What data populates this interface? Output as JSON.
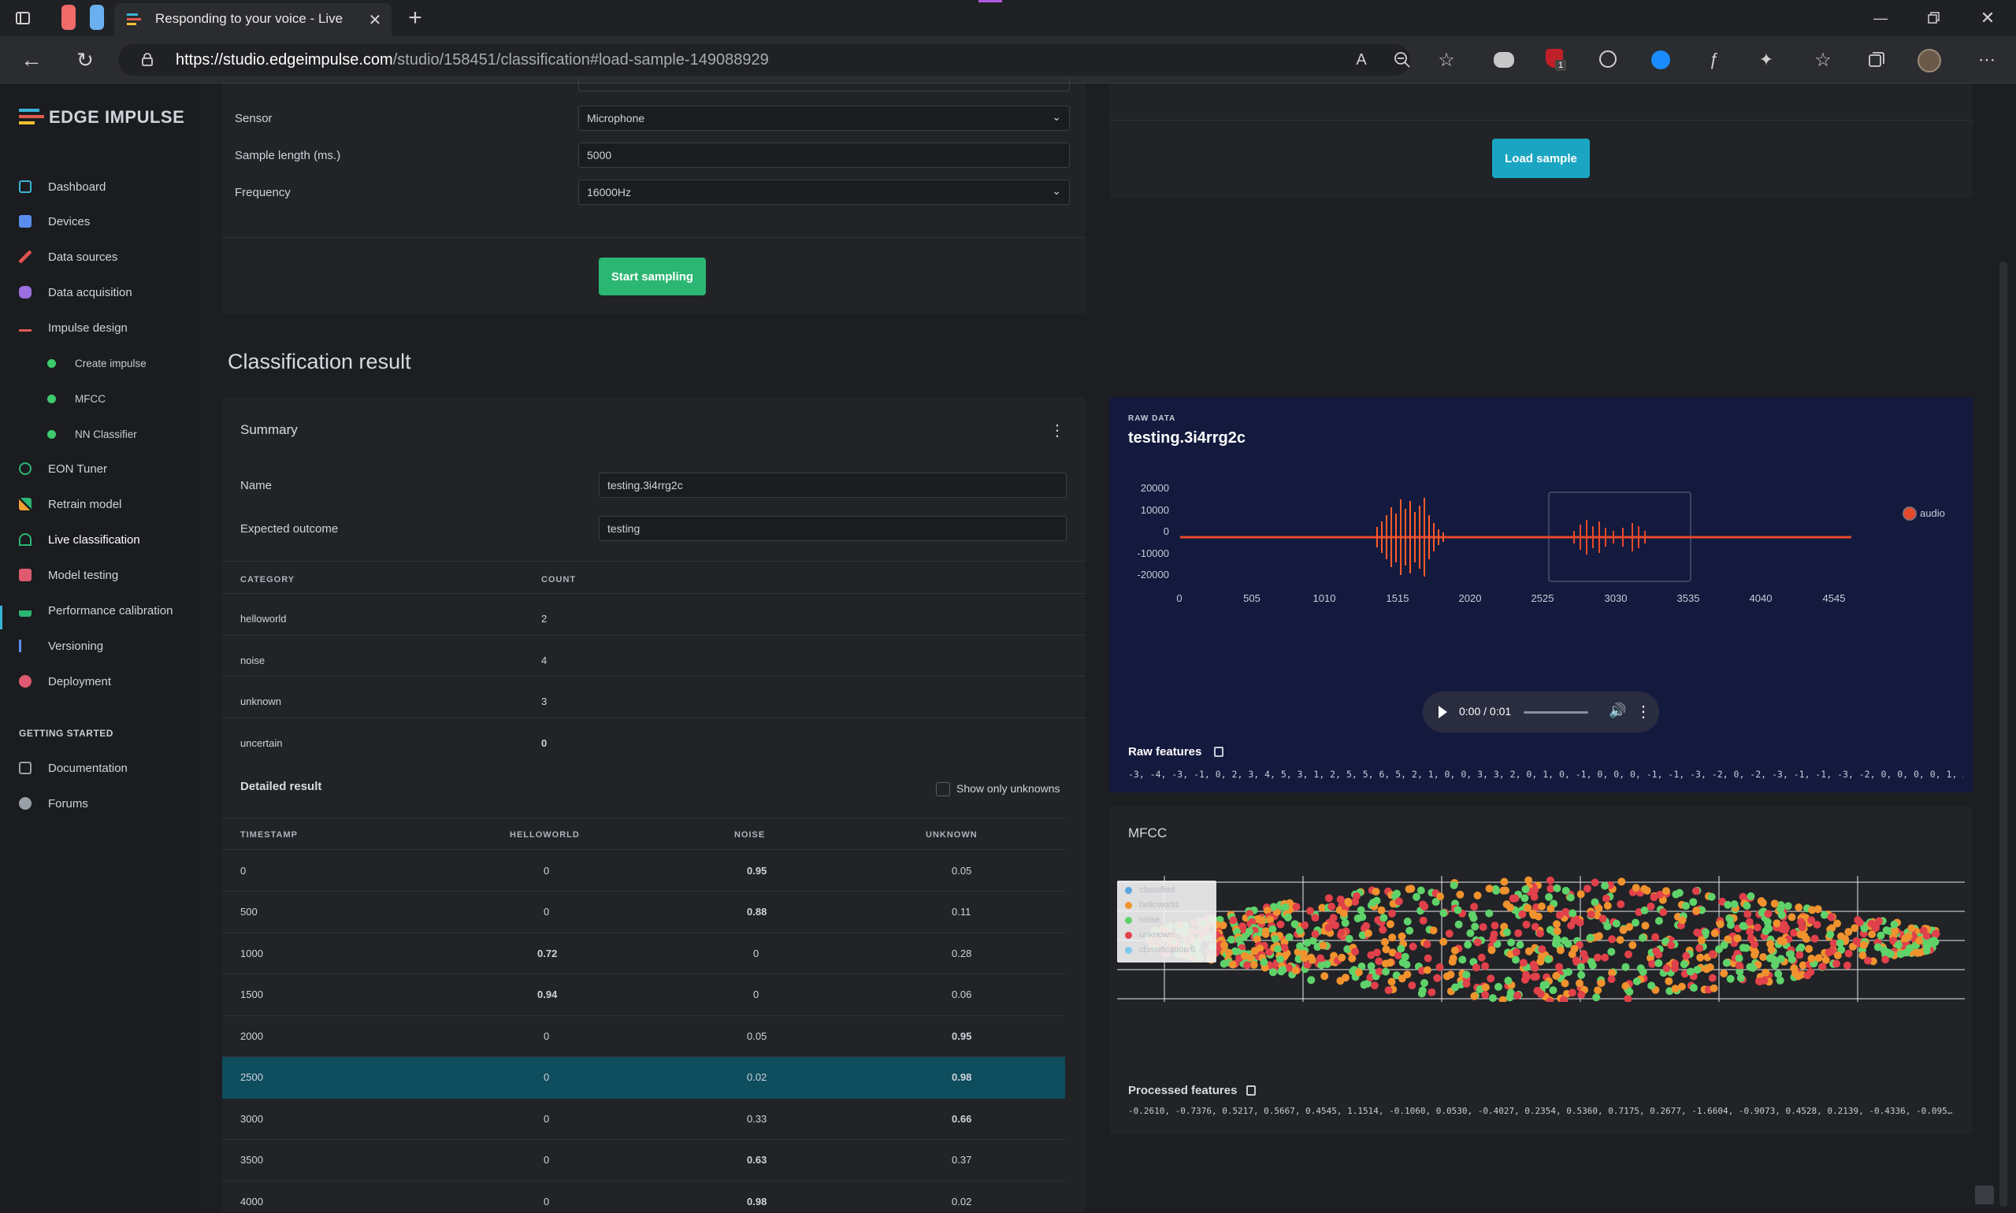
{
  "browser": {
    "tab_title": "Responding to your voice - Live",
    "url_host": "https://studio.edgeimpulse.com",
    "url_path": "/studio/158451/classification#load-sample-149088929",
    "new_tab": "+",
    "ext_badge": "1"
  },
  "sidebar": {
    "logo": "EDGE IMPULSE",
    "items": [
      {
        "label": "Dashboard",
        "color": "#3bb3d6"
      },
      {
        "label": "Devices",
        "color": "#5b8def"
      },
      {
        "label": "Data sources",
        "color": "#e0524f"
      },
      {
        "label": "Data acquisition",
        "color": "#9b6fe0"
      },
      {
        "label": "Impulse design",
        "color": "#e05a4f"
      }
    ],
    "subitems": [
      "Create impulse",
      "MFCC",
      "NN Classifier"
    ],
    "items2": [
      {
        "label": "EON Tuner",
        "color": "#2bb673"
      },
      {
        "label": "Retrain model",
        "color": "#f0a030"
      },
      {
        "label": "Live classification",
        "color": "#2bb673"
      },
      {
        "label": "Model testing",
        "color": "#e05a6f"
      },
      {
        "label": "Performance calibration",
        "color": "#2bb673"
      },
      {
        "label": "Versioning",
        "color": "#5b8def"
      },
      {
        "label": "Deployment",
        "color": "#e05a6f"
      }
    ],
    "section": "GETTING STARTED",
    "help": [
      {
        "label": "Documentation"
      },
      {
        "label": "Forums"
      }
    ]
  },
  "sampling": {
    "sensor_label": "Sensor",
    "sensor_value": "Microphone",
    "length_label": "Sample length (ms.)",
    "length_value": "5000",
    "freq_label": "Frequency",
    "freq_value": "16000Hz",
    "start_button": "Start sampling",
    "load_button": "Load sample"
  },
  "classification": {
    "heading": "Classification result",
    "summary_title": "Summary",
    "name_label": "Name",
    "name_value": "testing.3i4rrg2c",
    "expected_label": "Expected outcome",
    "expected_value": "testing",
    "col_category": "CATEGORY",
    "col_count": "COUNT",
    "counts": [
      {
        "category": "helloworld",
        "count": "2"
      },
      {
        "category": "noise",
        "count": "4"
      },
      {
        "category": "unknown",
        "count": "3"
      },
      {
        "category": "uncertain",
        "count": "0"
      }
    ],
    "detailed_title": "Detailed result",
    "show_unknowns": "Show only unknowns",
    "detail_headers": [
      "TIMESTAMP",
      "HELLOWORLD",
      "NOISE",
      "UNKNOWN"
    ],
    "detail_rows": [
      {
        "t": "0",
        "h": "0",
        "n": "0.95",
        "u": "0.05",
        "best": "n"
      },
      {
        "t": "500",
        "h": "0",
        "n": "0.88",
        "u": "0.11",
        "best": "n"
      },
      {
        "t": "1000",
        "h": "0.72",
        "n": "0",
        "u": "0.28",
        "best": "h"
      },
      {
        "t": "1500",
        "h": "0.94",
        "n": "0",
        "u": "0.06",
        "best": "h"
      },
      {
        "t": "2000",
        "h": "0",
        "n": "0.05",
        "u": "0.95",
        "best": "u"
      },
      {
        "t": "2500",
        "h": "0",
        "n": "0.02",
        "u": "0.98",
        "best": "u",
        "selected": true
      },
      {
        "t": "3000",
        "h": "0",
        "n": "0.33",
        "u": "0.66",
        "best": "u"
      },
      {
        "t": "3500",
        "h": "0",
        "n": "0.63",
        "u": "0.37",
        "best": "n"
      },
      {
        "t": "4000",
        "h": "0",
        "n": "0.98",
        "u": "0.02",
        "best": "n"
      }
    ]
  },
  "raw": {
    "kicker": "RAW DATA",
    "title": "testing.3i4rrg2c",
    "legend": "audio",
    "yticks": [
      "20000",
      "10000",
      "0",
      "-10000",
      "-20000"
    ],
    "xticks": [
      "0",
      "505",
      "1010",
      "1515",
      "2020",
      "2525",
      "3030",
      "3535",
      "4040",
      "4545"
    ],
    "audio_time": "0:00 / 0:01",
    "features_label": "Raw features",
    "features_text": "-3, -4, -3, -1, 0, 2, 3, 4, 5, 3, 1, 2, 5, 5, 6, 5, 2, 1, 0, 0, 3, 3, 2, 0, 1, 0, -1, 0, 0, 0, -1, -1, -3, -2, 0, -2, -3, -1, -1, -3, -2, 0, 0, 0, 0, 1, …"
  },
  "mfcc": {
    "title": "MFCC",
    "legend": [
      {
        "label": "classified",
        "color": "#5aa7e0"
      },
      {
        "label": "helloworld",
        "color": "#f0922e"
      },
      {
        "label": "noise",
        "color": "#5fd36a"
      },
      {
        "label": "unknown",
        "color": "#e0414a"
      },
      {
        "label": "classification 5",
        "color": "#7ec8f0"
      }
    ],
    "features_label": "Processed features",
    "features_text": "-0.2610, -0.7376, 0.5217, 0.5667, 0.4545, 1.1514, -0.1060, 0.0530, -0.4027, 0.2354, 0.5360, 0.7175, 0.2677, -1.6604, -0.9073, 0.4528, 0.2139, -0.4336, -0.095…"
  }
}
